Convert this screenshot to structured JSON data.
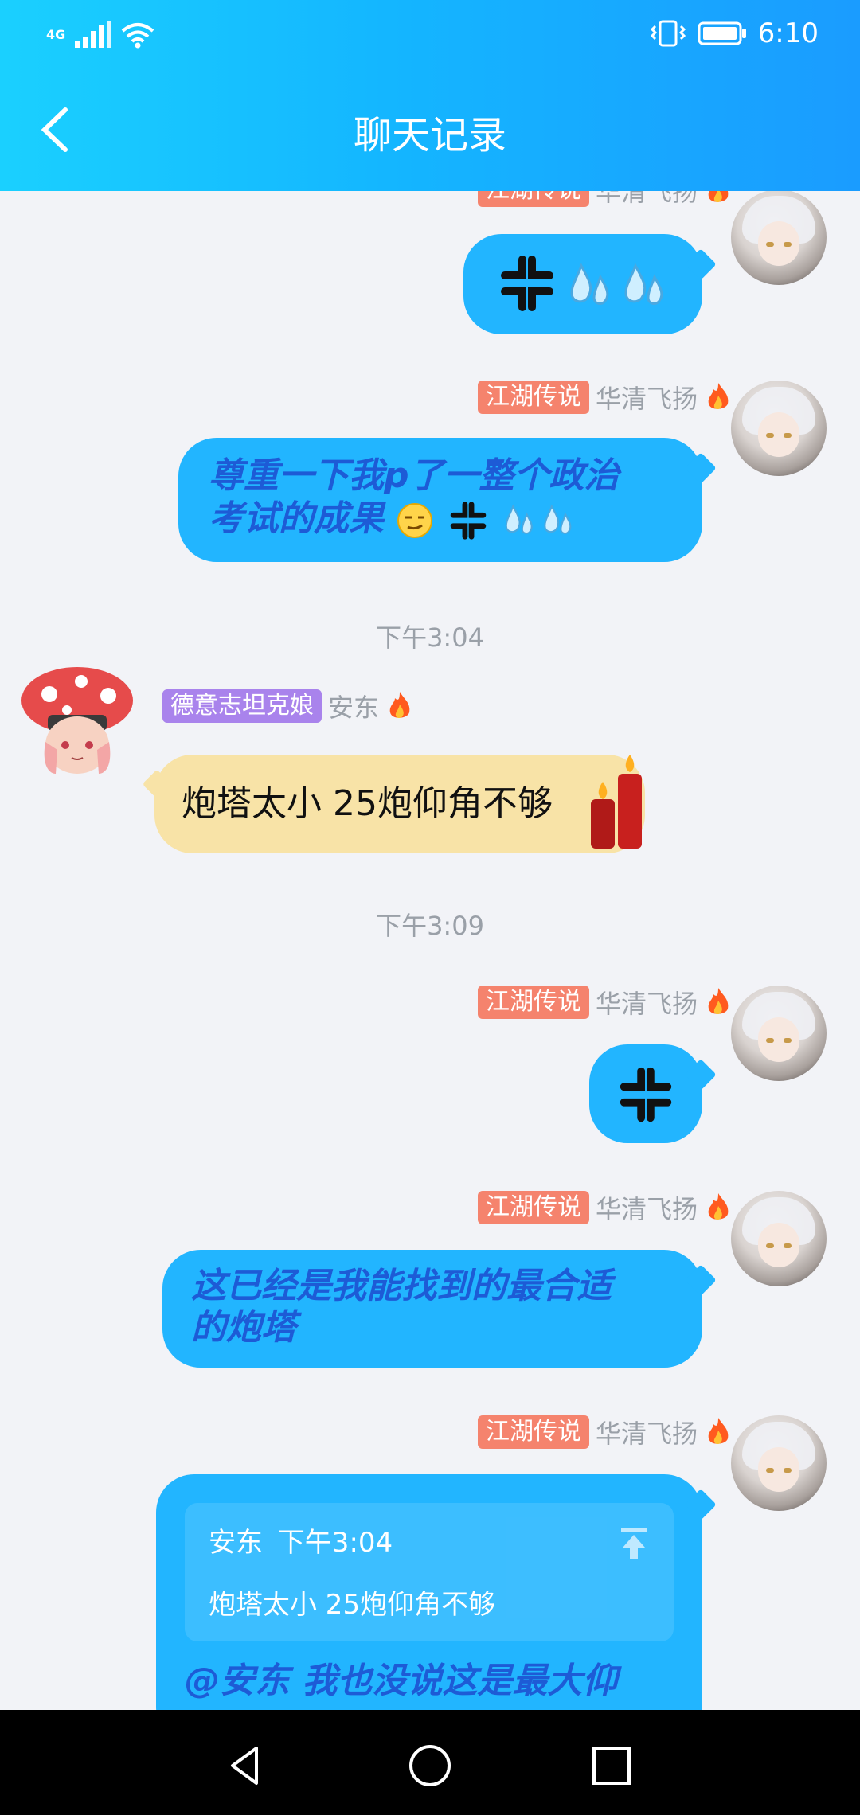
{
  "status": {
    "network": "4G",
    "time": "6:10"
  },
  "header": {
    "title": "聊天记录"
  },
  "time_separators": [
    "下午3:04",
    "下午3:09"
  ],
  "messages": [
    {
      "tag": "江湖传说",
      "nick": "华清飞扬"
    },
    {
      "tag": "江湖传说",
      "nick": "华清飞扬",
      "text_line1": "尊重一下我p了一整个政治",
      "text_line2": "考试的成果"
    },
    {
      "tag": "德意志坦克娘",
      "nick": "安东",
      "text": "炮塔太小 25炮仰角不够"
    },
    {
      "tag": "江湖传说",
      "nick": "华清飞扬"
    },
    {
      "tag": "江湖传说",
      "nick": "华清飞扬",
      "text_line1": "这已经是我能找到的最合适",
      "text_line2": "的炮塔"
    },
    {
      "tag": "江湖传说",
      "nick": "华清飞扬",
      "quote": {
        "author": "安东",
        "time": "下午3:04",
        "text": "炮塔太小 25炮仰角不够"
      },
      "text_line1": "@安东 我也没说这是最大仰"
    }
  ],
  "colors": {
    "header_gradient_start": "#1ad0ff",
    "header_gradient_end": "#1a9cff",
    "bubble_blue": "#22b5ff",
    "bubble_yellow": "#f8e3a7",
    "tag_salmon": "#f5836d",
    "tag_purple": "#a983ec",
    "message_text_blue": "#1d5bd6"
  },
  "icons": {
    "back": "chevron-left-icon",
    "signal": "signal-icon",
    "wifi": "wifi-icon",
    "vibrate": "vibrate-icon",
    "battery": "battery-icon",
    "fire": "fire-icon",
    "anger": "anger-emoji",
    "sweat": "sweat-drops-emoji",
    "candle": "candle-sticker",
    "pin": "scroll-to-quote-icon",
    "nav_back": "nav-back-icon",
    "nav_home": "nav-home-icon",
    "nav_recents": "nav-recents-icon"
  }
}
